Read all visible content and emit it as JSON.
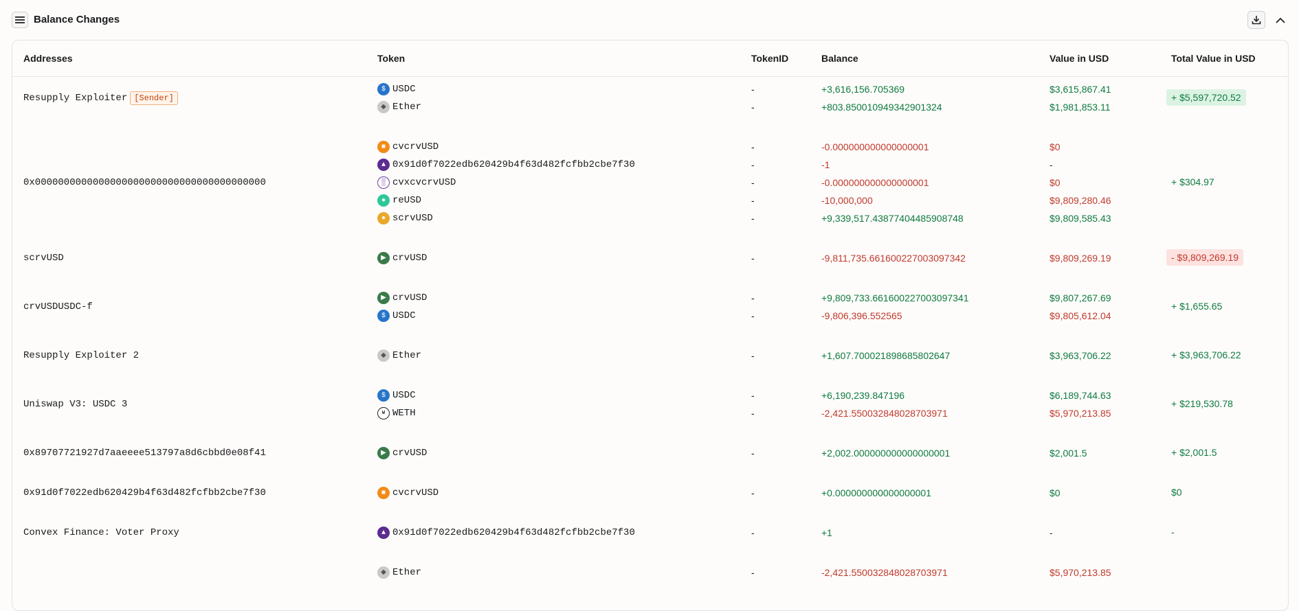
{
  "header": {
    "title": "Balance Changes"
  },
  "colors": {
    "positive": "#0f7a3e",
    "negative": "#c0392b"
  },
  "columns": [
    "Addresses",
    "Token",
    "TokenID",
    "Balance",
    "Value in USD",
    "Total Value in USD"
  ],
  "rows": [
    {
      "address": "Resupply Exploiter",
      "badge": "[Sender]",
      "total": "+ $5,597,720.52",
      "total_sign": "pos",
      "total_bg": true,
      "lines": [
        {
          "token": "USDC",
          "icon": "usdc-icon",
          "token_id": "-",
          "balance": "+3,616,156.705369",
          "bal_sign": "pos",
          "usd": "$3,615,867.41",
          "usd_sign": "pos"
        },
        {
          "token": "Ether",
          "icon": "ether-icon",
          "token_id": "-",
          "balance": "+803.850010949342901324",
          "bal_sign": "pos",
          "usd": "$1,981,853.11",
          "usd_sign": "pos"
        }
      ]
    },
    {
      "address": "0x0000000000000000000000000000000000000000",
      "badge": "",
      "total": "+ $304.97",
      "total_sign": "pos",
      "total_bg": false,
      "lines": [
        {
          "token": "cvcrvUSD",
          "icon": "cvcrvusd-icon",
          "token_id": "-",
          "balance": "-0.000000000000000001",
          "bal_sign": "neg",
          "usd": "$0",
          "usd_sign": "neg"
        },
        {
          "token": "0x91d0f7022edb620429b4f63d482fcfbb2cbe7f30",
          "icon": "token-contract-icon",
          "token_id": "-",
          "balance": "-1",
          "bal_sign": "neg",
          "usd": "-",
          "usd_sign": "neu"
        },
        {
          "token": "cvxcvcrvUSD",
          "icon": "cvxcvcrvusd-icon",
          "token_id": "-",
          "balance": "-0.000000000000000001",
          "bal_sign": "neg",
          "usd": "$0",
          "usd_sign": "neg"
        },
        {
          "token": "reUSD",
          "icon": "reusd-icon",
          "token_id": "-",
          "balance": "-10,000,000",
          "bal_sign": "neg",
          "usd": "$9,809,280.46",
          "usd_sign": "neg"
        },
        {
          "token": "scrvUSD",
          "icon": "scrvusd-icon",
          "token_id": "-",
          "balance": "+9,339,517.43877404485908748",
          "bal_sign": "pos",
          "usd": "$9,809,585.43",
          "usd_sign": "pos"
        }
      ]
    },
    {
      "address": "scrvUSD",
      "badge": "",
      "total": "- $9,809,269.19",
      "total_sign": "neg",
      "total_bg": true,
      "lines": [
        {
          "token": "crvUSD",
          "icon": "crvusd-icon",
          "token_id": "-",
          "balance": "-9,811,735.661600227003097342",
          "bal_sign": "neg",
          "usd": "$9,809,269.19",
          "usd_sign": "neg"
        }
      ]
    },
    {
      "address": "crvUSDUSDC-f",
      "badge": "",
      "total": "+ $1,655.65",
      "total_sign": "pos",
      "total_bg": false,
      "lines": [
        {
          "token": "crvUSD",
          "icon": "crvusd-icon",
          "token_id": "-",
          "balance": "+9,809,733.661600227003097341",
          "bal_sign": "pos",
          "usd": "$9,807,267.69",
          "usd_sign": "pos"
        },
        {
          "token": "USDC",
          "icon": "usdc-icon",
          "token_id": "-",
          "balance": "-9,806,396.552565",
          "bal_sign": "neg",
          "usd": "$9,805,612.04",
          "usd_sign": "neg"
        }
      ]
    },
    {
      "address": "Resupply Exploiter 2",
      "badge": "",
      "total": "+ $3,963,706.22",
      "total_sign": "pos",
      "total_bg": false,
      "lines": [
        {
          "token": "Ether",
          "icon": "ether-icon",
          "token_id": "-",
          "balance": "+1,607.700021898685802647",
          "bal_sign": "pos",
          "usd": "$3,963,706.22",
          "usd_sign": "pos"
        }
      ]
    },
    {
      "address": "Uniswap V3: USDC 3",
      "badge": "",
      "total": "+ $219,530.78",
      "total_sign": "pos",
      "total_bg": false,
      "lines": [
        {
          "token": "USDC",
          "icon": "usdc-icon",
          "token_id": "-",
          "balance": "+6,190,239.847196",
          "bal_sign": "pos",
          "usd": "$6,189,744.63",
          "usd_sign": "pos"
        },
        {
          "token": "WETH",
          "icon": "weth-icon",
          "token_id": "-",
          "balance": "-2,421.550032848028703971",
          "bal_sign": "neg",
          "usd": "$5,970,213.85",
          "usd_sign": "neg"
        }
      ]
    },
    {
      "address": "0x89707721927d7aaeeee513797a8d6cbbd0e08f41",
      "badge": "",
      "total": "+ $2,001.5",
      "total_sign": "pos",
      "total_bg": false,
      "lines": [
        {
          "token": "crvUSD",
          "icon": "crvusd-icon",
          "token_id": "-",
          "balance": "+2,002.000000000000000001",
          "bal_sign": "pos",
          "usd": "$2,001.5",
          "usd_sign": "pos"
        }
      ]
    },
    {
      "address": "0x91d0f7022edb620429b4f63d482fcfbb2cbe7f30",
      "badge": "",
      "total": "$0",
      "total_sign": "pos",
      "total_bg": false,
      "lines": [
        {
          "token": "cvcrvUSD",
          "icon": "cvcrvusd-icon",
          "token_id": "-",
          "balance": "+0.000000000000000001",
          "bal_sign": "pos",
          "usd": "$0",
          "usd_sign": "pos"
        }
      ]
    },
    {
      "address": "Convex Finance: Voter Proxy",
      "badge": "",
      "total": "-",
      "total_sign": "pos",
      "total_bg": false,
      "lines": [
        {
          "token": "0x91d0f7022edb620429b4f63d482fcfbb2cbe7f30",
          "icon": "token-contract-icon",
          "token_id": "-",
          "balance": "+1",
          "bal_sign": "pos",
          "usd": "-",
          "usd_sign": "neu"
        }
      ]
    },
    {
      "address": "",
      "badge": "",
      "total": "",
      "total_sign": "pos",
      "total_bg": false,
      "lines": [
        {
          "token": "Ether",
          "icon": "ether-icon",
          "token_id": "-",
          "balance": "-2,421.550032848028703971",
          "bal_sign": "neg",
          "usd": "$5,970,213.85",
          "usd_sign": "neg"
        }
      ]
    }
  ]
}
